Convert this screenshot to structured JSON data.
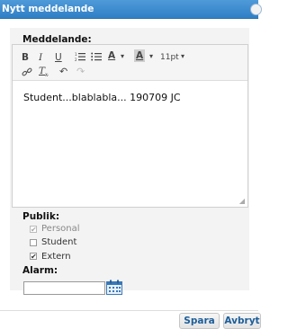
{
  "dialog": {
    "title": "Nytt meddelande"
  },
  "message": {
    "label": "Meddelande:",
    "content": "Student...blablabla... 190709 JC"
  },
  "toolbar": {
    "bold": "B",
    "italic": "I",
    "underline": "U",
    "font_size": "11pt",
    "text_color": "A",
    "bg_color": "A"
  },
  "audience": {
    "label": "Publik:",
    "options": [
      {
        "label": "Personal",
        "checked": true,
        "disabled": true
      },
      {
        "label": "Student",
        "checked": false,
        "disabled": false
      },
      {
        "label": "Extern",
        "checked": true,
        "disabled": false
      }
    ]
  },
  "alarm": {
    "label": "Alarm:",
    "value": ""
  },
  "buttons": {
    "save": "Spara",
    "cancel": "Avbryt"
  },
  "colors": {
    "title_bar": "#2f7fc6",
    "button_text": "#1d5e99"
  }
}
